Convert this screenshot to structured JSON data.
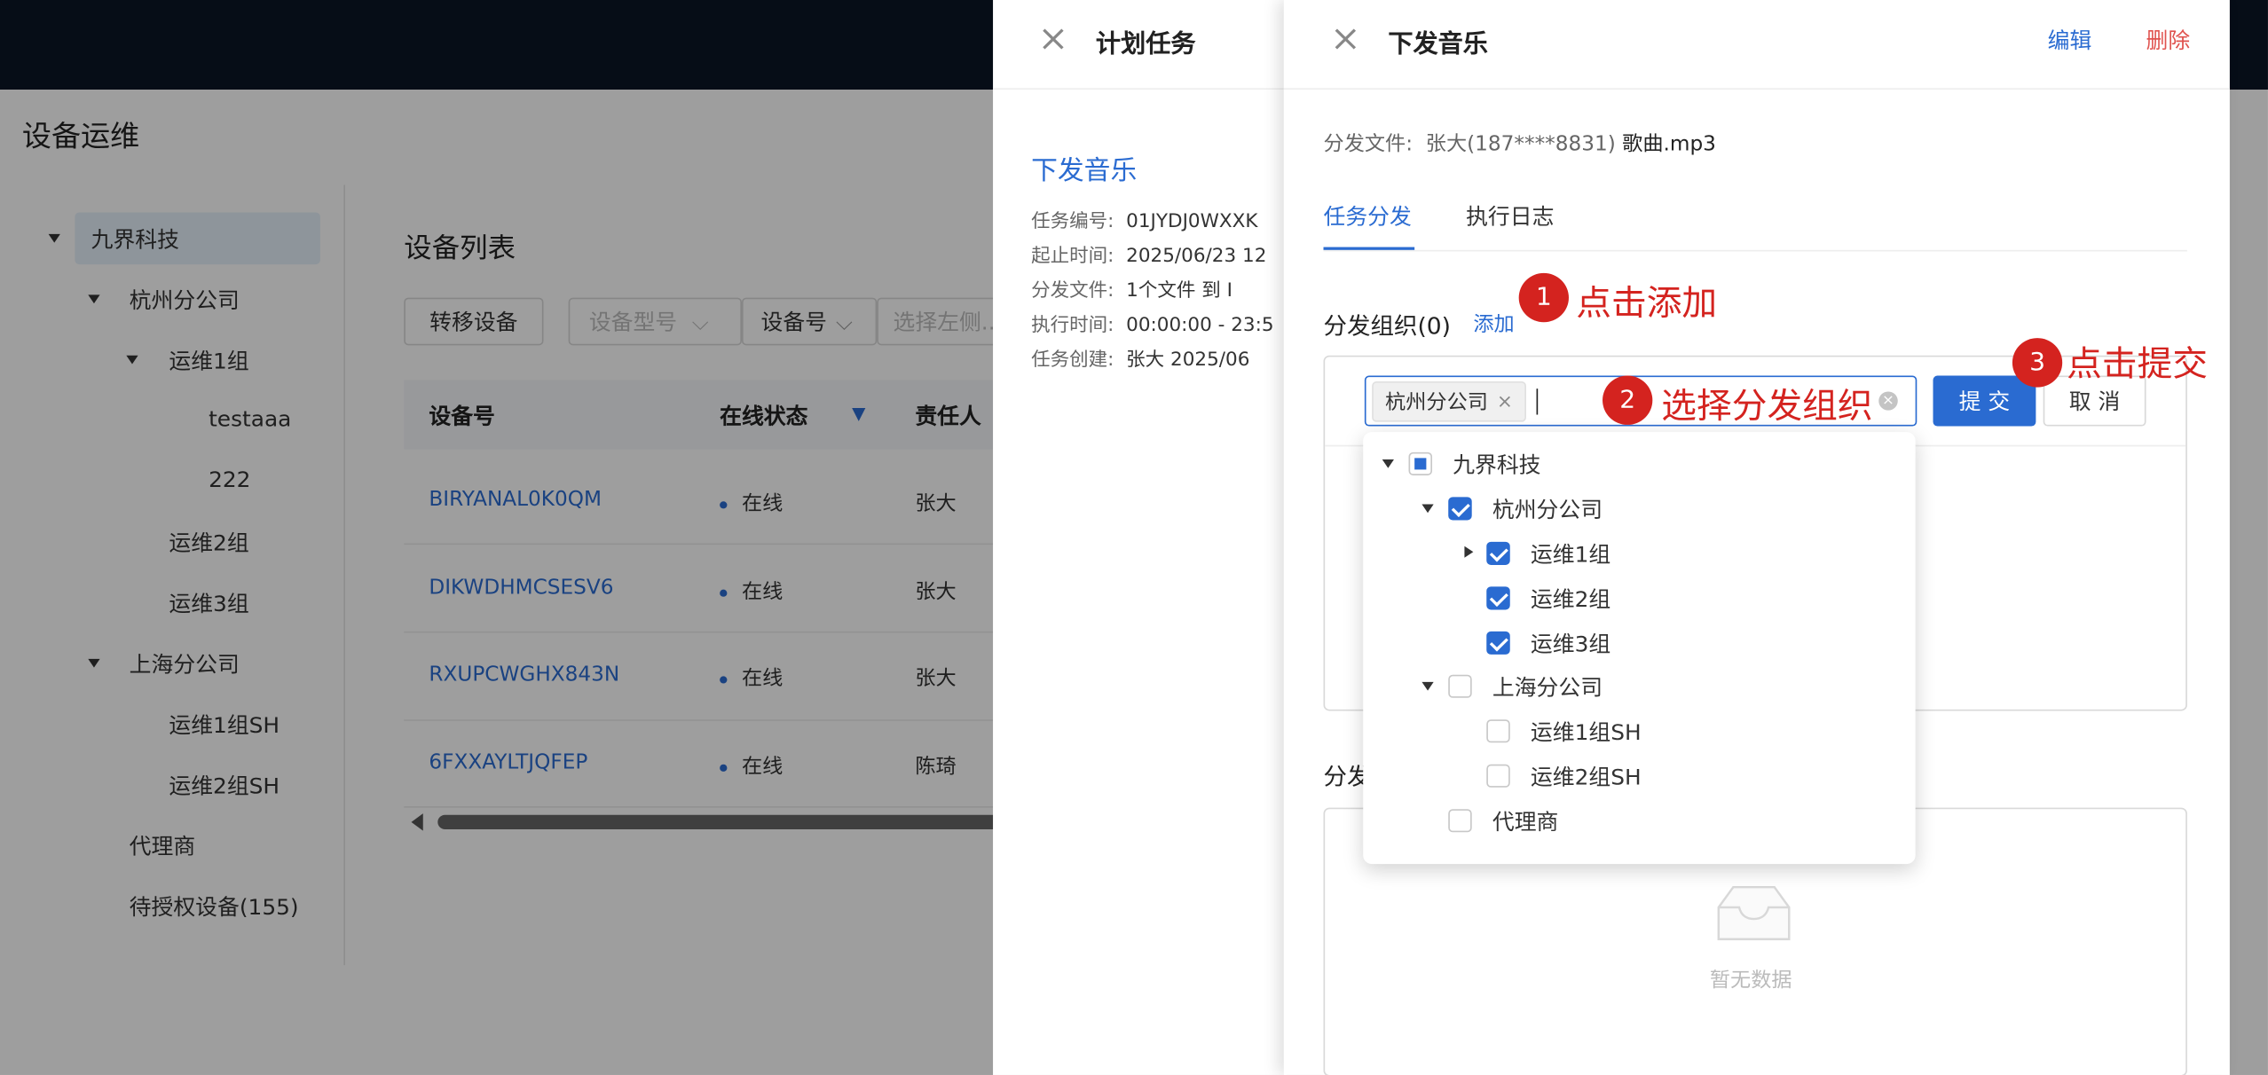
{
  "page": {
    "title": "设备运维"
  },
  "tree": {
    "items": [
      {
        "label": "九界科技"
      },
      {
        "label": "杭州分公司"
      },
      {
        "label": "运维1组"
      },
      {
        "label": "testaaa"
      },
      {
        "label": "222"
      },
      {
        "label": "运维2组"
      },
      {
        "label": "运维3组"
      },
      {
        "label": "上海分公司"
      },
      {
        "label": "运维1组SH"
      },
      {
        "label": "运维2组SH"
      },
      {
        "label": "代理商"
      },
      {
        "label": "待授权设备(155)"
      }
    ]
  },
  "device_list": {
    "title": "设备列表",
    "transfer_button": "转移设备",
    "filters": {
      "type_placeholder": "设备型号",
      "number_select": "设备号",
      "search_placeholder": "选择左侧..."
    },
    "columns": [
      "设备号",
      "在线状态",
      "责任人"
    ],
    "rows": [
      {
        "id": "BIRYANAL0K0QM",
        "status": "在线",
        "owner": "张大"
      },
      {
        "id": "DIKWDHMCSESV6",
        "status": "在线",
        "owner": "张大"
      },
      {
        "id": "RXUPCWGHX843N",
        "status": "在线",
        "owner": "张大"
      },
      {
        "id": "6FXXAYLTJQFEP",
        "status": "在线",
        "owner": "陈琦"
      }
    ]
  },
  "plan_drawer": {
    "title": "计划任务",
    "task_name": "下发音乐",
    "fields": [
      {
        "label": "任务编号:",
        "value": "01JYDJ0WXXK"
      },
      {
        "label": "起止时间:",
        "value": "2025/06/23 12"
      },
      {
        "label": "分发文件:",
        "value": "1个文件  到  I"
      },
      {
        "label": "执行时间:",
        "value": "00:00:00 - 23:5"
      },
      {
        "label": "任务创建:",
        "value": "张大  2025/06"
      }
    ]
  },
  "music_drawer": {
    "title": "下发音乐",
    "edit": "编辑",
    "delete": "删除",
    "file_label": "分发文件:",
    "file_owner": "张大(187****8831)",
    "file_name": "歌曲.mp3",
    "tabs": [
      "任务分发",
      "执行日志"
    ],
    "org_section": "分发组织(0)",
    "add_link": "添加",
    "selected_tag": "杭州分公司",
    "submit": "提 交",
    "cancel": "取 消",
    "section2_label": "分发",
    "empty_text": "暂无数据"
  },
  "org_picker": {
    "items": [
      {
        "label": "九界科技",
        "state": "partial"
      },
      {
        "label": "杭州分公司",
        "state": "checked"
      },
      {
        "label": "运维1组",
        "state": "checked"
      },
      {
        "label": "运维2组",
        "state": "checked"
      },
      {
        "label": "运维3组",
        "state": "checked"
      },
      {
        "label": "上海分公司",
        "state": "unchecked"
      },
      {
        "label": "运维1组SH",
        "state": "unchecked"
      },
      {
        "label": "运维2组SH",
        "state": "unchecked"
      },
      {
        "label": "代理商",
        "state": "unchecked"
      }
    ]
  },
  "annotations": [
    {
      "num": "1",
      "text": "点击添加"
    },
    {
      "num": "2",
      "text": "选择分发组织"
    },
    {
      "num": "3",
      "text": "点击提交"
    }
  ],
  "colors": {
    "accent": "#2a6bd1",
    "danger": "#e0534f",
    "annotation": "#d4231f",
    "topbar": "#0b1526"
  }
}
